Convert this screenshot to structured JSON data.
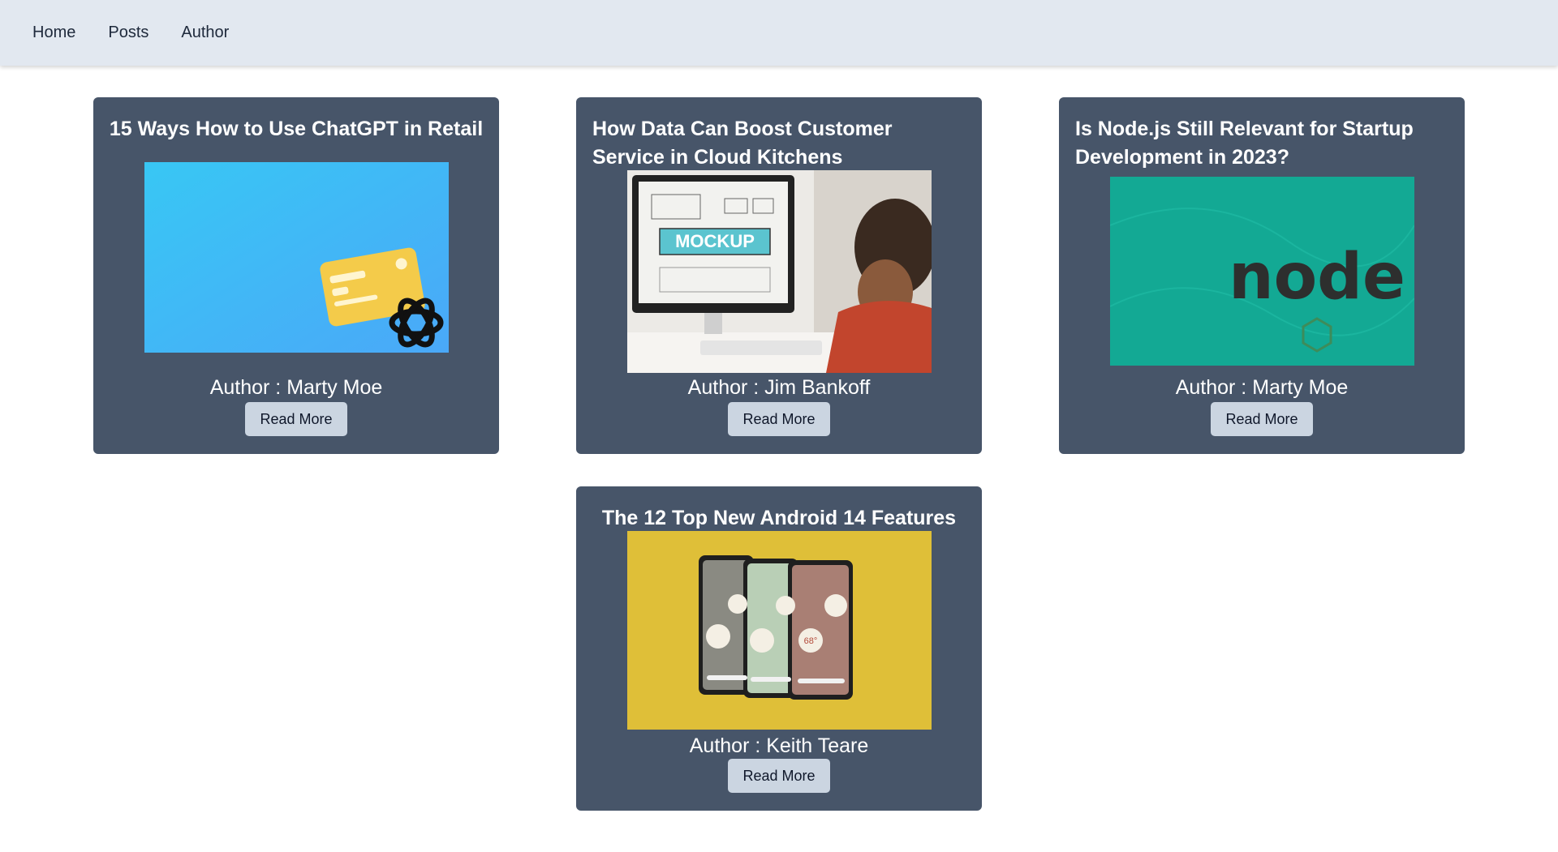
{
  "nav": {
    "home": "Home",
    "posts": "Posts",
    "author": "Author"
  },
  "posts": [
    {
      "title": "15 Ways How to Use ChatGPT in Retail",
      "author": "Author : Marty Moe",
      "button": "Read More"
    },
    {
      "title": "How Data Can Boost Customer Service in Cloud Kitchens",
      "author": "Author : Jim Bankoff",
      "button": "Read More",
      "image_text": "MOCKUP"
    },
    {
      "title": "Is Node.js Still Relevant for Startup Development in 2023?",
      "author": "Author : Marty Moe",
      "button": "Read More",
      "image_text": "node"
    },
    {
      "title": "The 12 Top New Android 14 Features",
      "author": "Author : Keith Teare",
      "button": "Read More",
      "image_text": "68°"
    }
  ],
  "colors": {
    "navbar": "#e2e8f0",
    "card": "#475569",
    "button": "#cbd5e1"
  }
}
